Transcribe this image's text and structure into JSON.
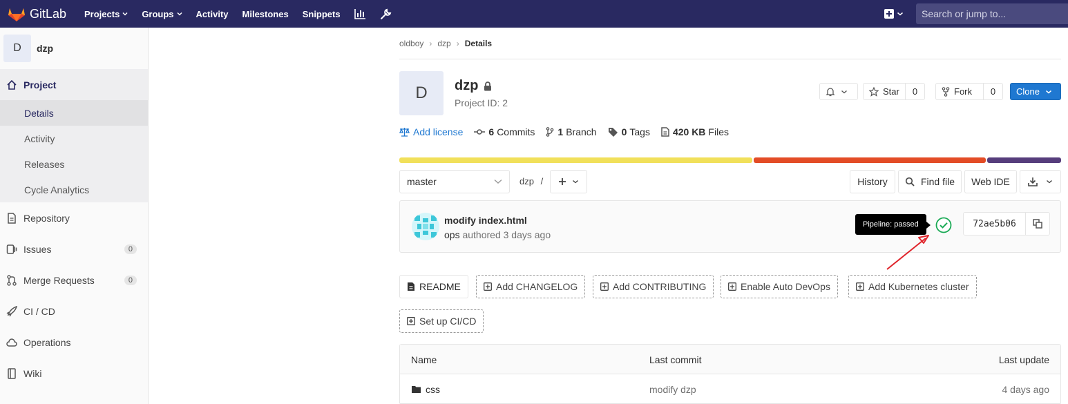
{
  "navbar": {
    "brand": "GitLab",
    "links": [
      {
        "label": "Projects",
        "dropdown": true
      },
      {
        "label": "Groups",
        "dropdown": true
      },
      {
        "label": "Activity",
        "dropdown": false
      },
      {
        "label": "Milestones",
        "dropdown": false
      },
      {
        "label": "Snippets",
        "dropdown": false
      }
    ],
    "search_placeholder": "Search or jump to..."
  },
  "sidebar": {
    "avatar_letter": "D",
    "project_name": "dzp",
    "items": [
      {
        "label": "Project",
        "icon": "home-icon"
      },
      {
        "label": "Repository",
        "icon": "doc-icon"
      },
      {
        "label": "Issues",
        "icon": "issues-icon",
        "count": "0"
      },
      {
        "label": "Merge Requests",
        "icon": "merge-icon",
        "count": "0"
      },
      {
        "label": "CI / CD",
        "icon": "rocket-icon"
      },
      {
        "label": "Operations",
        "icon": "cloud-icon"
      },
      {
        "label": "Wiki",
        "icon": "book-icon"
      }
    ],
    "subitems": [
      "Details",
      "Activity",
      "Releases",
      "Cycle Analytics"
    ]
  },
  "breadcrumb": [
    "oldboy",
    "dzp",
    "Details"
  ],
  "project": {
    "avatar_letter": "D",
    "title": "dzp",
    "id_text": "Project ID: 2",
    "star_label": "Star",
    "star_count": "0",
    "fork_label": "Fork",
    "fork_count": "0",
    "clone_label": "Clone"
  },
  "stats": {
    "license": "Add license",
    "commits_num": "6",
    "commits_label": "Commits",
    "branch_num": "1",
    "branch_label": "Branch",
    "tags_num": "0",
    "tags_label": "Tags",
    "files_num": "420 KB",
    "files_label": "Files"
  },
  "colors": {
    "lang1": "#f1e05a",
    "lang2": "#e34c26",
    "lang3": "#563d7c",
    "accent": "#1f78d1",
    "nav": "#292961",
    "pipeline": "#1aaa55"
  },
  "toolbar": {
    "branch": "master",
    "path": "dzp",
    "history": "History",
    "find_file": "Find file",
    "web_ide": "Web IDE"
  },
  "commit": {
    "title": "modify index.html",
    "author": "ops",
    "meta": "authored 3 days ago",
    "tooltip": "Pipeline: passed",
    "sha": "72ae5b06"
  },
  "quick_actions": [
    "README",
    "Add CHANGELOG",
    "Add CONTRIBUTING",
    "Enable Auto DevOps",
    "Add Kubernetes cluster",
    "Set up CI/CD"
  ],
  "table": {
    "headers": [
      "Name",
      "Last commit",
      "Last update"
    ],
    "rows": [
      {
        "name": "css",
        "commit": "modify dzp",
        "updated": "4 days ago"
      }
    ]
  }
}
